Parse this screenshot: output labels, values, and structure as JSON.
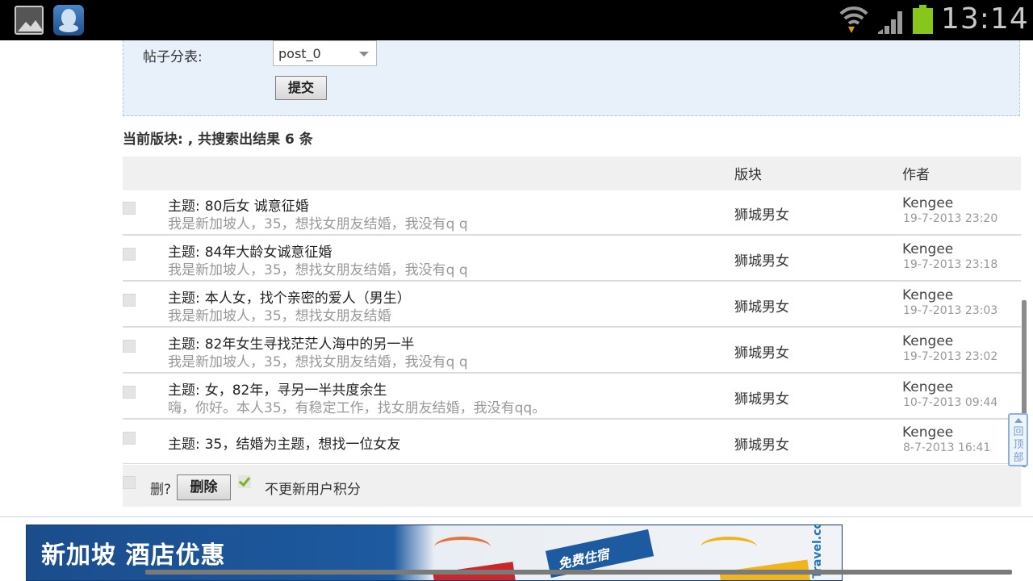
{
  "status_bar": {
    "time": "13:14",
    "icons": [
      "gallery-icon",
      "qq-icon",
      "wifi-icon",
      "signal-icon",
      "battery-icon"
    ],
    "battery_color": "#86c61d"
  },
  "search_form": {
    "table_label": "帖子分表:",
    "table_value": "post_0",
    "submit_label": "提交"
  },
  "results": {
    "summary": "当前版块: , 共搜索出结果 6 条",
    "columns": {
      "board": "版块",
      "author": "作者"
    },
    "rows": [
      {
        "subject_prefix": "主题:",
        "subject": "80后女 诚意征婚",
        "excerpt": "我是新加坡人，35，想找女朋友结婚，我没有q q",
        "board": "狮城男女",
        "author": "Kengee",
        "date": "19-7-2013 23:20"
      },
      {
        "subject_prefix": "主题:",
        "subject": "84年大龄女诚意征婚",
        "excerpt": "我是新加坡人，35，想找女朋友结婚，我没有q q",
        "board": "狮城男女",
        "author": "Kengee",
        "date": "19-7-2013 23:18"
      },
      {
        "subject_prefix": "主题:",
        "subject": "本人女，找个亲密的爱人（男生）",
        "excerpt": "我是新加坡人，35，想找女朋友结婚",
        "board": "狮城男女",
        "author": "Kengee",
        "date": "19-7-2013 23:03"
      },
      {
        "subject_prefix": "主题:",
        "subject": "82年女生寻找茫茫人海中的另一半",
        "excerpt": "我是新加坡人，35，想找女朋友结婚，我没有q q",
        "board": "狮城男女",
        "author": "Kengee",
        "date": "19-7-2013 23:02"
      },
      {
        "subject_prefix": "主题:",
        "subject": "女，82年，寻另一半共度余生",
        "excerpt": "嗨，你好。本人35，有稳定工作，找女朋友结婚，我没有qq。",
        "board": "狮城男女",
        "author": "Kengee",
        "date": "10-7-2013 09:44"
      },
      {
        "subject_prefix": "主题:",
        "subject": "35，结婚为主题，想找一位女友",
        "excerpt": "",
        "board": "狮城男女",
        "author": "Kengee",
        "date": "8-7-2013 16:41"
      }
    ]
  },
  "footer": {
    "delete_question": "删?",
    "delete_label": "删除",
    "no_update_label": "不更新用户积分"
  },
  "back_to_top": "回顶部",
  "banner": {
    "title": "新加坡 酒店优惠",
    "tagline": "免费住宿",
    "logo": "Travel.com",
    "colors": {
      "blue": "#1d5aa0",
      "red": "#c8282a",
      "yellow": "#f0b41c"
    }
  }
}
